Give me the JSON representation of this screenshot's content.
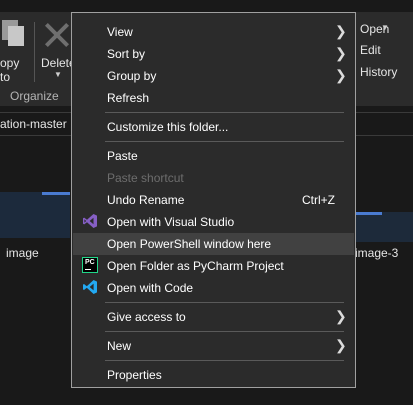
{
  "explorer": {
    "copy_label": "opy",
    "copy_label_line2": "to",
    "delete_label": "Delete",
    "organize_group": "Organize",
    "open_label": "Open",
    "edit_label": "Edit",
    "history_label": "History",
    "address_text": "ation-master",
    "files": [
      {
        "label": "image"
      },
      {
        "label": "image-3"
      }
    ]
  },
  "context_menu": {
    "view": "View",
    "sort_by": "Sort by",
    "group_by": "Group by",
    "refresh": "Refresh",
    "customize": "Customize this folder...",
    "paste": "Paste",
    "paste_shortcut": "Paste shortcut",
    "undo_rename": "Undo Rename",
    "undo_shortcut": "Ctrl+Z",
    "open_visual_studio": "Open with Visual Studio",
    "open_powershell": "Open PowerShell window here",
    "open_pycharm": "Open Folder as PyCharm Project",
    "open_vscode": "Open with Code",
    "give_access": "Give access to",
    "new": "New",
    "properties": "Properties",
    "pycharm_icon_text": "PC"
  },
  "colors": {
    "menu_background": "#2b2b2b",
    "hover_highlight": "#414141",
    "visual_studio_purple": "#865fc5",
    "vscode_blue": "#23a9f2",
    "pycharm_green": "#21d789"
  },
  "icons": {
    "submenu": "chevron-right-icon",
    "visual_studio": "visual-studio-icon",
    "pycharm": "pycharm-icon",
    "vscode": "vscode-icon"
  }
}
